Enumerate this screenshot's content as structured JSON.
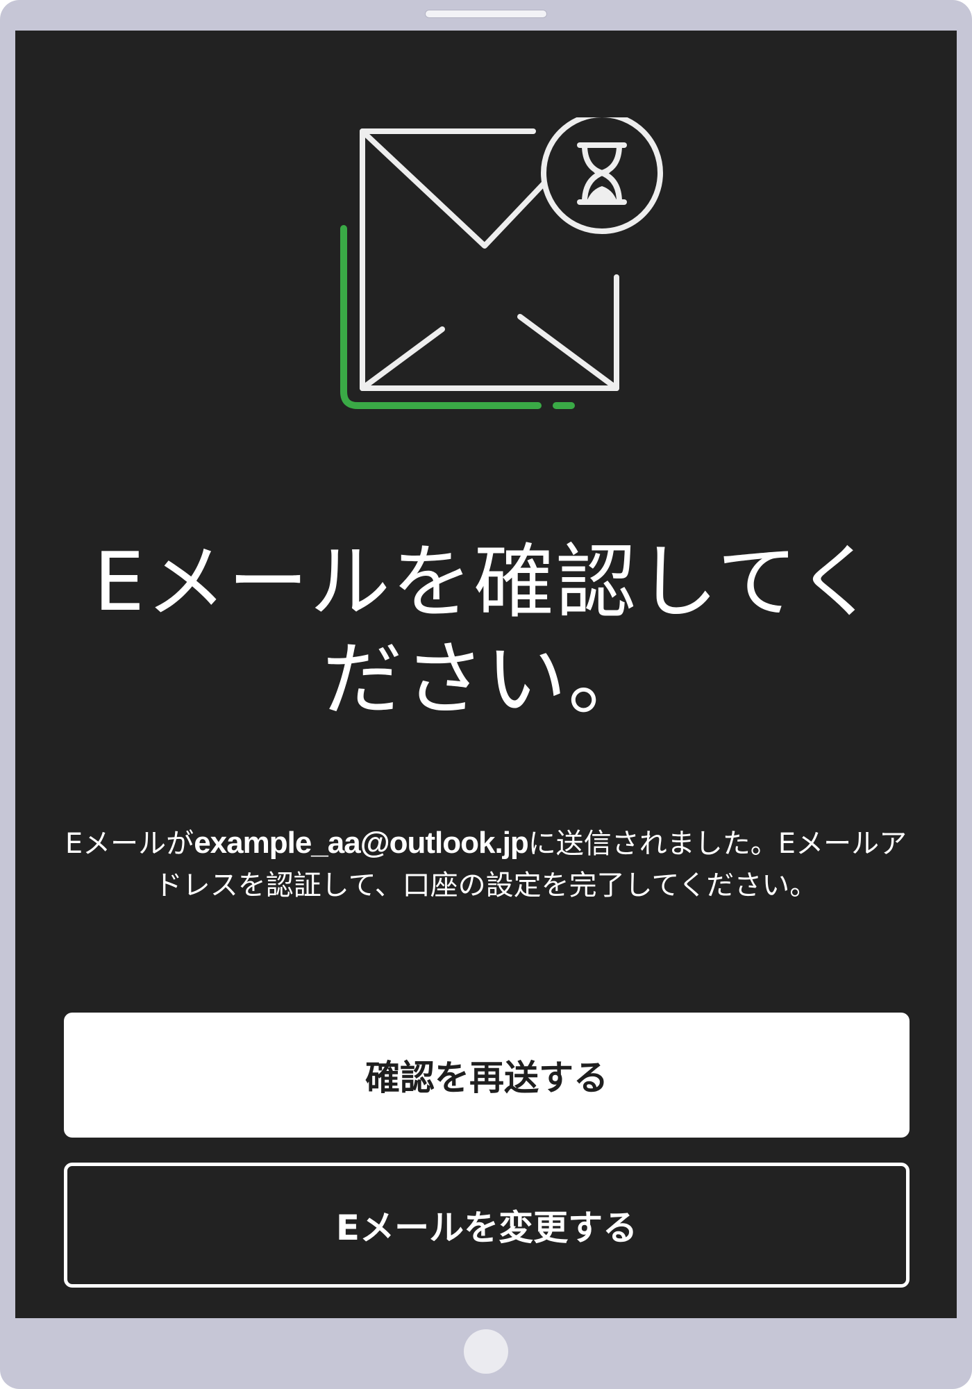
{
  "screen": {
    "title": "Eメールを確認してください。",
    "message_prefix": "Eメールが",
    "email": "example_aa@outlook.jp",
    "message_suffix": "に送信されました。Eメールアドレスを認証して、口座の設定を完了してください。",
    "buttons": {
      "resend_label": "確認を再送する",
      "change_email_label": "Eメールを変更する"
    }
  },
  "icons": {
    "illustration": "envelope-hourglass-icon"
  },
  "colors": {
    "background": "#222222",
    "accent_green": "#3aaa46",
    "line_art": "#eeeeee",
    "device_frame": "#c6c6d6"
  }
}
